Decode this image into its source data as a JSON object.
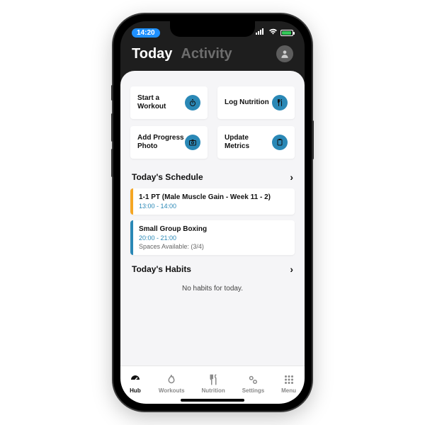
{
  "status": {
    "time": "14:20"
  },
  "header": {
    "tabs": {
      "today": "Today",
      "activity": "Activity"
    }
  },
  "quick_actions": [
    {
      "label": "Start a Workout",
      "icon": "stopwatch"
    },
    {
      "label": "Log Nutrition",
      "icon": "utensils"
    },
    {
      "label": "Add Progress Photo",
      "icon": "camera"
    },
    {
      "label": "Update Metrics",
      "icon": "clipboard"
    }
  ],
  "sections": {
    "schedule": {
      "title": "Today's Schedule",
      "items": [
        {
          "title": "1-1 PT (Male Muscle Gain - Week 11 - 2)",
          "time": "13:00 - 14:00",
          "color": "orange"
        },
        {
          "title": "Small Group Boxing",
          "time": "20:00 - 21:00",
          "meta": "Spaces Available: (3/4)",
          "color": "blue"
        }
      ]
    },
    "habits": {
      "title": "Today's Habits",
      "empty_text": "No habits for today."
    }
  },
  "bottom_nav": [
    {
      "label": "Hub",
      "icon": "gauge",
      "active": true
    },
    {
      "label": "Workouts",
      "icon": "flame",
      "active": false
    },
    {
      "label": "Nutrition",
      "icon": "utensils",
      "active": false
    },
    {
      "label": "Settings",
      "icon": "gears",
      "active": false
    },
    {
      "label": "Menu",
      "icon": "grid",
      "active": false
    }
  ]
}
